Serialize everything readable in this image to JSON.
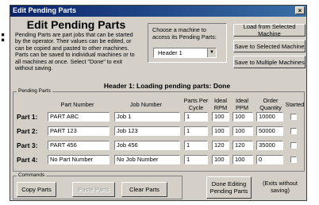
{
  "outside_mark": ":",
  "window": {
    "title": "Edit Pending Parts",
    "close_glyph": "×"
  },
  "intro": {
    "heading": "Edit Pending Parts",
    "description": "Pending Parts are part jobs that can be started by the operator. Their values can be edited, or can be copied and pasted to other machines. Parts can be saved to individual machines or to all machines at once. Select \"Done\" to exit without saving."
  },
  "machine_picker": {
    "prompt": "Choose a machine to access its Pending Parts:",
    "selected": "Header 1"
  },
  "actions": {
    "load": "Load from Selected Machine",
    "save": "Save to Selected Machine",
    "save_multiple": "Save to Multiple Machines"
  },
  "status": "Header 1: Loading pending parts: Done",
  "pending_group": {
    "caption": "Pending Parts",
    "columns": {
      "part_number": "Part Number",
      "job_number": "Job Number",
      "parts_per_cycle": "Parts Per Cycle",
      "ideal_rpm": "Ideal RPM",
      "ideal_ppm": "Ideal PPM",
      "order_quantity": "Order Quantity",
      "started": "Started"
    },
    "rows": [
      {
        "label": "Part 1:",
        "part": "PART ABC",
        "job": "Job 1",
        "ppc": "1",
        "rpm": "100",
        "ppm": "100",
        "qty": "10000",
        "started": false
      },
      {
        "label": "Part 2:",
        "part": "PART 123",
        "job": "Job 123",
        "ppc": "1",
        "rpm": "100",
        "ppm": "100",
        "qty": "50000",
        "started": false
      },
      {
        "label": "Part 3:",
        "part": "PART 456",
        "job": "Job 456",
        "ppc": "1",
        "rpm": "120",
        "ppm": "120",
        "qty": "35000",
        "started": false
      },
      {
        "label": "Part 4:",
        "part": "No Part Number",
        "job": "No Job Number",
        "ppc": "1",
        "rpm": "100",
        "ppm": "100",
        "qty": "0",
        "started": false
      }
    ]
  },
  "commands": {
    "caption": "Commands",
    "copy": "Copy Parts",
    "paste": "Paste Parts",
    "clear": "Clear Parts"
  },
  "done": {
    "label": "Done Editing Pending Parts",
    "note": "(Exits without saving)"
  }
}
